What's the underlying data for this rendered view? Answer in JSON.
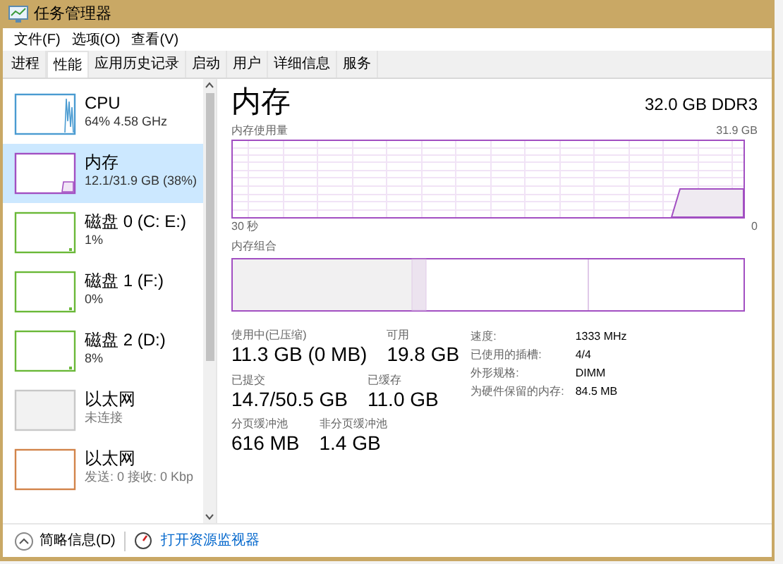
{
  "window": {
    "title": "任务管理器"
  },
  "menu": [
    "文件(F)",
    "选项(O)",
    "查看(V)"
  ],
  "tabs": [
    {
      "label": "进程",
      "selected": false
    },
    {
      "label": "性能",
      "selected": true
    },
    {
      "label": "应用历史记录",
      "selected": false
    },
    {
      "label": "启动",
      "selected": false
    },
    {
      "label": "用户",
      "selected": false
    },
    {
      "label": "详细信息",
      "selected": false
    },
    {
      "label": "服务",
      "selected": false
    }
  ],
  "sidebar": {
    "items": [
      {
        "kind": "cpu",
        "name": "CPU",
        "detail": "64% 4.58 GHz",
        "color": "#4a9bd1",
        "selected": false
      },
      {
        "kind": "memory",
        "name": "内存",
        "detail": "12.1/31.9 GB (38%)",
        "color": "#a24fc2",
        "selected": true
      },
      {
        "kind": "disk",
        "name": "磁盘 0 (C: E:)",
        "detail": "1%",
        "color": "#6ab838",
        "selected": false
      },
      {
        "kind": "disk",
        "name": "磁盘 1 (F:)",
        "detail": "0%",
        "color": "#6ab838",
        "selected": false
      },
      {
        "kind": "disk",
        "name": "磁盘 2 (D:)",
        "detail": "8%",
        "color": "#6ab838",
        "selected": false
      },
      {
        "kind": "offline",
        "name": "以太网",
        "detail": "未连接",
        "color": "#c8c8c8",
        "selected": false
      },
      {
        "kind": "ethernet",
        "name": "以太网",
        "detail": "发送: 0 接收: 0 Kbp",
        "color": "#d2844a",
        "selected": false
      }
    ]
  },
  "detail": {
    "title": "内存",
    "spec": "32.0 GB DDR3",
    "usage_label": "内存使用量",
    "usage_max": "31.9 GB",
    "time_start": "30 秒",
    "time_end": "0",
    "composition_label": "内存组合",
    "stats": [
      [
        {
          "label": "使用中(已压缩)",
          "value": "11.3 GB (0 MB)"
        },
        {
          "label": "可用",
          "value": "19.8 GB"
        }
      ],
      [
        {
          "label": "已提交",
          "value": "14.7/50.5 GB"
        },
        {
          "label": "已缓存",
          "value": "11.0 GB"
        }
      ],
      [
        {
          "label": "分页缓冲池",
          "value": "616 MB"
        },
        {
          "label": "非分页缓冲池",
          "value": "1.4 GB"
        }
      ]
    ],
    "properties": [
      {
        "key": "速度:",
        "value": "1333 MHz"
      },
      {
        "key": "已使用的插槽:",
        "value": "4/4"
      },
      {
        "key": "外形规格:",
        "value": "DIMM"
      },
      {
        "key": "为硬件保留的内存:",
        "value": "84.5 MB"
      }
    ]
  },
  "footer": {
    "fewer_details": "简略信息(D)",
    "open_monitor": "打开资源监视器"
  }
}
